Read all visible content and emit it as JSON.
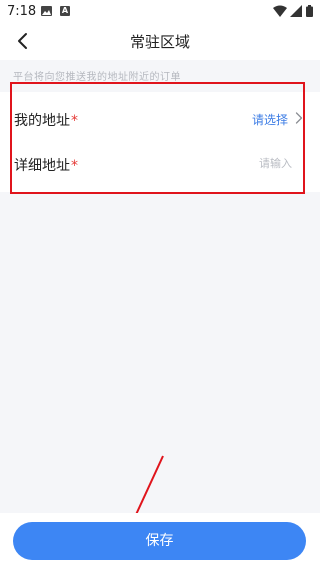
{
  "status_bar": {
    "time": "7:18",
    "icons": [
      "image-icon",
      "a-icon",
      "wifi-icon",
      "signal-icon",
      "battery-icon"
    ]
  },
  "nav": {
    "title": "常驻区域",
    "back_icon": "chevron-left-icon"
  },
  "hint": "平台将向您推送我的地址附近的订单",
  "form": {
    "address": {
      "label": "我的地址",
      "required_mark": "*",
      "value": "请选择",
      "icon": "chevron-right-icon"
    },
    "detail": {
      "label": "详细地址",
      "required_mark": "*",
      "placeholder": "请输入",
      "value": ""
    }
  },
  "footer": {
    "save_label": "保存"
  },
  "colors": {
    "accent": "#3d86f4",
    "link": "#3d7de5",
    "required": "#e53935",
    "annotation": "#e0141c",
    "background": "#f5f6f9"
  }
}
